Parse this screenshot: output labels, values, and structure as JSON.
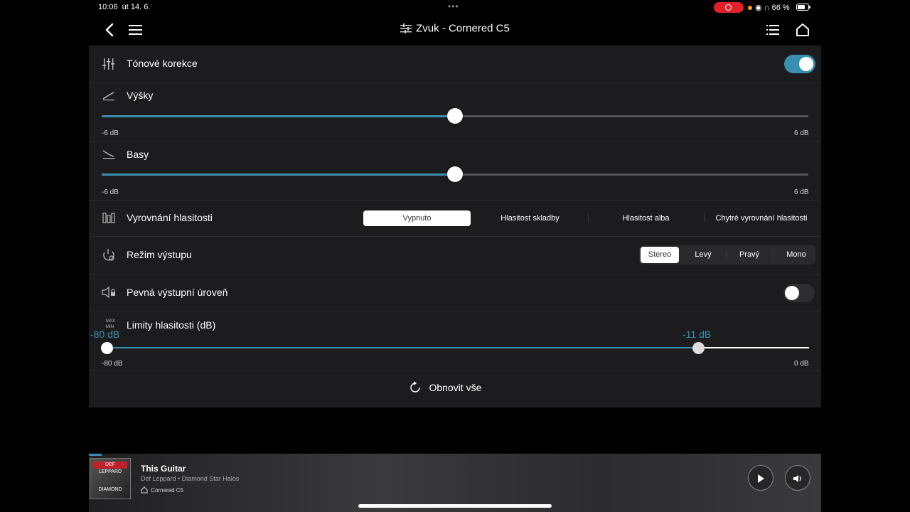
{
  "status": {
    "time": "10:06",
    "date": "út 14. 6.",
    "battery": "66 %",
    "icons": "wifi headphones"
  },
  "nav": {
    "back_icon": "chevron-left-icon",
    "menu_icon": "hamburger-icon",
    "title": "Zvuk - Cornered C5",
    "title_icon": "sliders-icon",
    "list_icon": "list-icon",
    "home_icon": "home-icon"
  },
  "tone": {
    "label": "Tónové korekce",
    "enabled": true
  },
  "treble": {
    "label": "Výšky",
    "min": "-6 dB",
    "max": "6 dB",
    "value": 0
  },
  "bass": {
    "label": "Basy",
    "min": "-6 dB",
    "max": "6 dB",
    "value": 0
  },
  "loudness": {
    "label": "Vyrovnání hlasitosti",
    "options": [
      "Vypnuto",
      "Hlasitost skladby",
      "Hlasitost alba",
      "Chytré vyrovnání hlasitosti"
    ],
    "selected": "Vypnuto"
  },
  "output": {
    "label": "Režim výstupu",
    "options": [
      "Stereo",
      "Levý",
      "Pravý",
      "Mono"
    ],
    "selected": "Stereo"
  },
  "fixed": {
    "label": "Pevná výstupní úroveň",
    "enabled": false
  },
  "limits": {
    "label": "Limity hlasitosti (dB)",
    "icon_text_max": "MAX",
    "icon_text_min": "MIN",
    "low_value": "-80 dB",
    "high_value": "-11 dB",
    "min": "-80 dB",
    "max": "0 dB"
  },
  "reset": {
    "label": "Obnovit vše"
  },
  "player": {
    "cover_band": "DEF LEPPARD",
    "cover_album": "DIAMOND",
    "track": "This Guitar",
    "artist_album": "Def Leppard • Diamond Star Halos",
    "device": "Cornered C5",
    "play_icon": "play-icon",
    "volume_icon": "speaker-icon"
  },
  "colors": {
    "accent": "#3a8fb0",
    "panel": "#1c1c1e"
  }
}
